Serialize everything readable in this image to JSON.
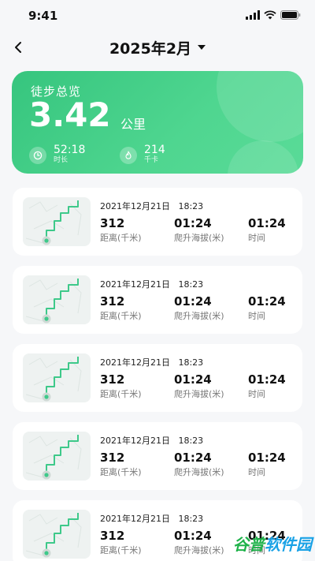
{
  "status_bar": {
    "time": "9:41"
  },
  "header": {
    "month": "2025年2月"
  },
  "summary": {
    "title": "徒步总览",
    "distance": "3.42",
    "unit": "公里",
    "duration_value": "52:18",
    "duration_label": "时长",
    "calories_value": "214",
    "calories_label": "千卡"
  },
  "records": [
    {
      "date": "2021年12月21日   18:23",
      "distance": "312",
      "distance_label": "距离(千米)",
      "ascent": "01:24",
      "ascent_label": "爬升海拔(米)",
      "time": "01:24",
      "time_label": "时间"
    },
    {
      "date": "2021年12月21日   18:23",
      "distance": "312",
      "distance_label": "距离(千米)",
      "ascent": "01:24",
      "ascent_label": "爬升海拔(米)",
      "time": "01:24",
      "time_label": "时间"
    },
    {
      "date": "2021年12月21日   18:23",
      "distance": "312",
      "distance_label": "距离(千米)",
      "ascent": "01:24",
      "ascent_label": "爬升海拔(米)",
      "time": "01:24",
      "time_label": "时间"
    },
    {
      "date": "2021年12月21日   18:23",
      "distance": "312",
      "distance_label": "距离(千米)",
      "ascent": "01:24",
      "ascent_label": "爬升海拔(米)",
      "time": "01:24",
      "time_label": "时间"
    },
    {
      "date": "2021年12月21日   18:23",
      "distance": "312",
      "distance_label": "距离(千米)",
      "ascent": "01:24",
      "ascent_label": "爬升海拔(米)",
      "time": "01:24",
      "time_label": "时间"
    }
  ],
  "watermark": {
    "brand_green": "谷普",
    "brand_blue": "软件园"
  },
  "colors": {
    "accent": "#3fcf86",
    "route": "#3ec98a",
    "watermark_blue": "#1aa2e6",
    "watermark_green": "#1fb24a"
  },
  "icons": [
    "signal-icon",
    "wifi-icon",
    "battery-icon",
    "back-arrow-icon",
    "dropdown-triangle-icon",
    "clock-icon",
    "flame-icon",
    "route-map-icon"
  ]
}
